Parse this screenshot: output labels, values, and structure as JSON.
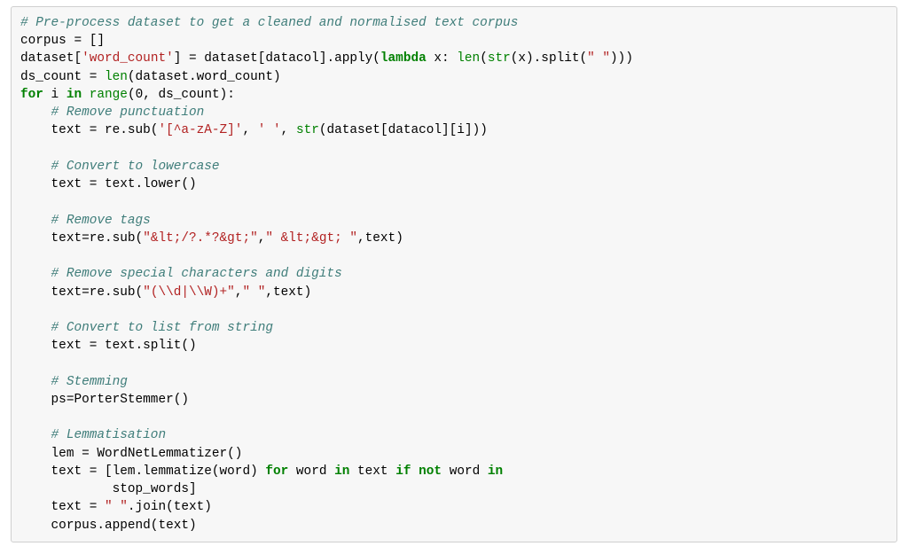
{
  "code": {
    "t00c": "# Pre-process dataset to get a cleaned and normalised text corpus",
    "t01": "corpus = []",
    "t02a": "dataset[",
    "t02s1": "'word_count'",
    "t02b": "] = dataset[datacol].apply(",
    "t02kw": "lambda",
    "t02c": " x: ",
    "t02bn1": "len",
    "t02d": "(",
    "t02bn2": "str",
    "t02e": "(x).split(",
    "t02s2": "\" \"",
    "t02f": ")))",
    "t03a": "ds_count = ",
    "t03bn": "len",
    "t03b": "(dataset.word_count)",
    "t04kw1": "for",
    "t04a": " i ",
    "t04kw2": "in",
    "t04b": " ",
    "t04bn": "range",
    "t04c": "(",
    "t04n0": "0",
    "t04d": ", ds_count):",
    "t05ind": "    ",
    "t05c": "# Remove punctuation",
    "t06ind": "    ",
    "t06a": "text = re.sub(",
    "t06s1": "'[^a-zA-Z]'",
    "t06b": ", ",
    "t06s2": "' '",
    "t06c": ", ",
    "t06bn": "str",
    "t06d": "(dataset[datacol][i]))",
    "t08ind": "    ",
    "t08c": "# Convert to lowercase",
    "t09ind": "    ",
    "t09a": "text = text.lower()",
    "t11ind": "    ",
    "t11c": "# Remove tags",
    "t12ind": "    ",
    "t12a": "text=re.sub(",
    "t12s1": "\"&lt;/?.*?&gt;\"",
    "t12b": ",",
    "t12s2": "\" &lt;&gt; \"",
    "t12c": ",text)",
    "t14ind": "    ",
    "t14c": "# Remove special characters and digits",
    "t15ind": "    ",
    "t15a": "text=re.sub(",
    "t15s1": "\"(\\\\d|\\\\W)+\"",
    "t15b": ",",
    "t15s2": "\" \"",
    "t15c": ",text)",
    "t17ind": "    ",
    "t17c": "# Convert to list from string",
    "t18ind": "    ",
    "t18a": "text = text.split()",
    "t20ind": "    ",
    "t20c": "# Stemming",
    "t21ind": "    ",
    "t21a": "ps=PorterStemmer()",
    "t23ind": "    ",
    "t23c": "# Lemmatisation",
    "t24ind": "    ",
    "t24a": "lem = WordNetLemmatizer()",
    "t25ind": "    ",
    "t25a": "text = [lem.lemmatize(word) ",
    "t25kw1": "for",
    "t25b": " word ",
    "t25kw2": "in",
    "t25c": " text ",
    "t25kw3": "if",
    "t25d": " ",
    "t25kw4": "not",
    "t25e": " word ",
    "t25kw5": "in",
    "t26ind": "            ",
    "t26a": "stop_words]",
    "t27ind": "    ",
    "t27a": "text = ",
    "t27s": "\" \"",
    "t27b": ".join(text)",
    "t28ind": "    ",
    "t28a": "corpus.append(text)"
  }
}
